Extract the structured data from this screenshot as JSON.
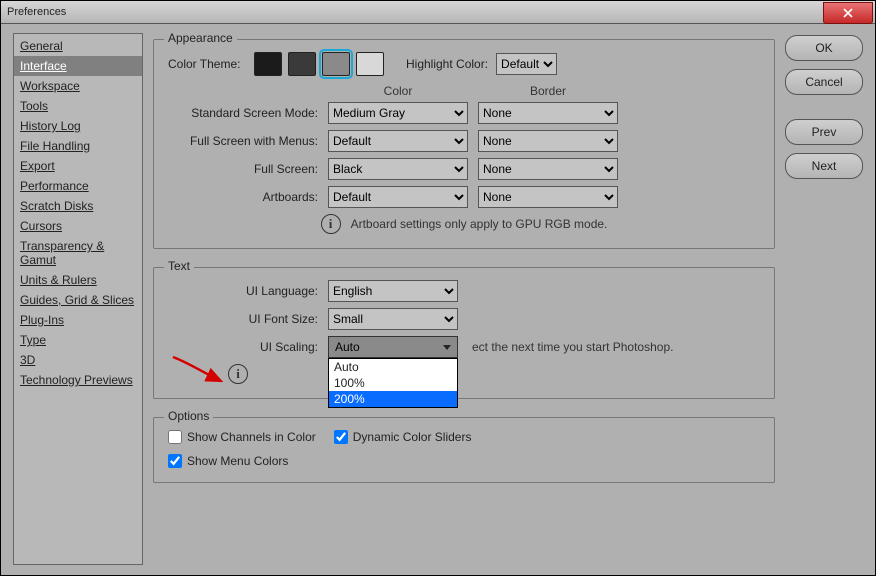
{
  "window": {
    "title": "Preferences"
  },
  "buttons": {
    "ok": "OK",
    "cancel": "Cancel",
    "prev": "Prev",
    "next": "Next"
  },
  "sidebar": {
    "items": [
      {
        "label": "General"
      },
      {
        "label": "Interface"
      },
      {
        "label": "Workspace"
      },
      {
        "label": "Tools"
      },
      {
        "label": "History Log"
      },
      {
        "label": "File Handling"
      },
      {
        "label": "Export"
      },
      {
        "label": "Performance"
      },
      {
        "label": "Scratch Disks"
      },
      {
        "label": "Cursors"
      },
      {
        "label": "Transparency & Gamut"
      },
      {
        "label": "Units & Rulers"
      },
      {
        "label": "Guides, Grid & Slices"
      },
      {
        "label": "Plug-Ins"
      },
      {
        "label": "Type"
      },
      {
        "label": "3D"
      },
      {
        "label": "Technology Previews"
      }
    ],
    "selected_index": 1
  },
  "appearance": {
    "title": "Appearance",
    "color_theme_label": "Color Theme:",
    "swatch_colors": [
      "#1b1b1b",
      "#3a3a3a",
      "#8a8a8a",
      "#d8d8d8"
    ],
    "selected_swatch": 2,
    "highlight_label": "Highlight Color:",
    "highlight_value": "Default",
    "columns": {
      "color": "Color",
      "border": "Border"
    },
    "modes": [
      {
        "label": "Standard Screen Mode:",
        "color": "Medium Gray",
        "border": "None"
      },
      {
        "label": "Full Screen with Menus:",
        "color": "Default",
        "border": "None"
      },
      {
        "label": "Full Screen:",
        "color": "Black",
        "border": "None"
      },
      {
        "label": "Artboards:",
        "color": "Default",
        "border": "None"
      }
    ],
    "artboard_note": "Artboard settings only apply to GPU RGB mode."
  },
  "text": {
    "title": "Text",
    "rows": [
      {
        "label": "UI Language:",
        "value": "English"
      },
      {
        "label": "UI Font Size:",
        "value": "Small"
      }
    ],
    "scaling_label": "UI Scaling:",
    "scaling_value": "Auto",
    "scaling_options": [
      "Auto",
      "100%",
      "200%"
    ],
    "scaling_highlight_index": 2,
    "restart_note": "ect the next time you start Photoshop."
  },
  "options": {
    "title": "Options",
    "items": [
      {
        "label": "Show Channels in Color",
        "checked": false
      },
      {
        "label": "Dynamic Color Sliders",
        "checked": true
      },
      {
        "label": "Show Menu Colors",
        "checked": true
      }
    ]
  }
}
